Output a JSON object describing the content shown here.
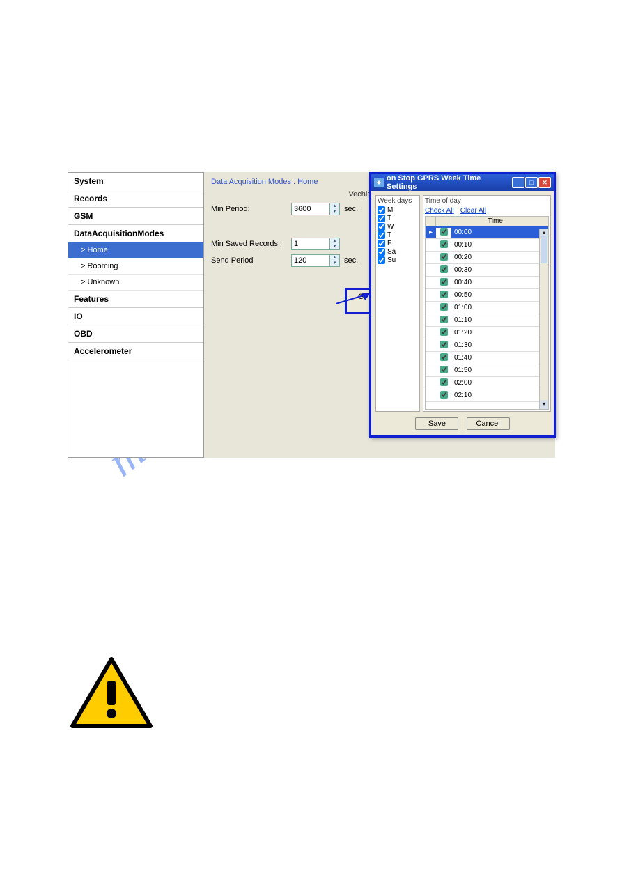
{
  "sidebar": {
    "items": [
      "System",
      "Records",
      "GSM",
      "DataAcquisitionModes",
      "Features",
      "IO",
      "OBD",
      "Accelerometer"
    ],
    "subitems": [
      "> Home",
      "> Rooming",
      "> Unknown"
    ]
  },
  "breadcrumb": "Data Acquisition Modes : Home",
  "group_title": "Vechicle on STOP",
  "form": {
    "min_period_label": "Min Period:",
    "min_period_value": "3600",
    "min_period_unit": "sec.",
    "min_saved_label": "Min Saved Records:",
    "min_saved_value": "1",
    "send_period_label": "Send Period",
    "send_period_value": "120",
    "send_period_unit": "sec."
  },
  "gprs_button": "GPRS Week Time",
  "dialog": {
    "title": "on Stop GPRS Week Time Settings",
    "weekdays_header": "Week days",
    "timeofday_header": "Time of day",
    "checkall": "Check All",
    "clearall": "Clear All",
    "time_col": "Time",
    "days": [
      "M",
      "T",
      "W",
      "T",
      "F",
      "Sa",
      "Su"
    ],
    "times": [
      "00:00",
      "00:10",
      "00:20",
      "00:30",
      "00:40",
      "00:50",
      "01:00",
      "01:10",
      "01:20",
      "01:30",
      "01:40",
      "01:50",
      "02:00",
      "02:10"
    ],
    "save": "Save",
    "cancel": "Cancel"
  },
  "watermark": "manualshive.co"
}
